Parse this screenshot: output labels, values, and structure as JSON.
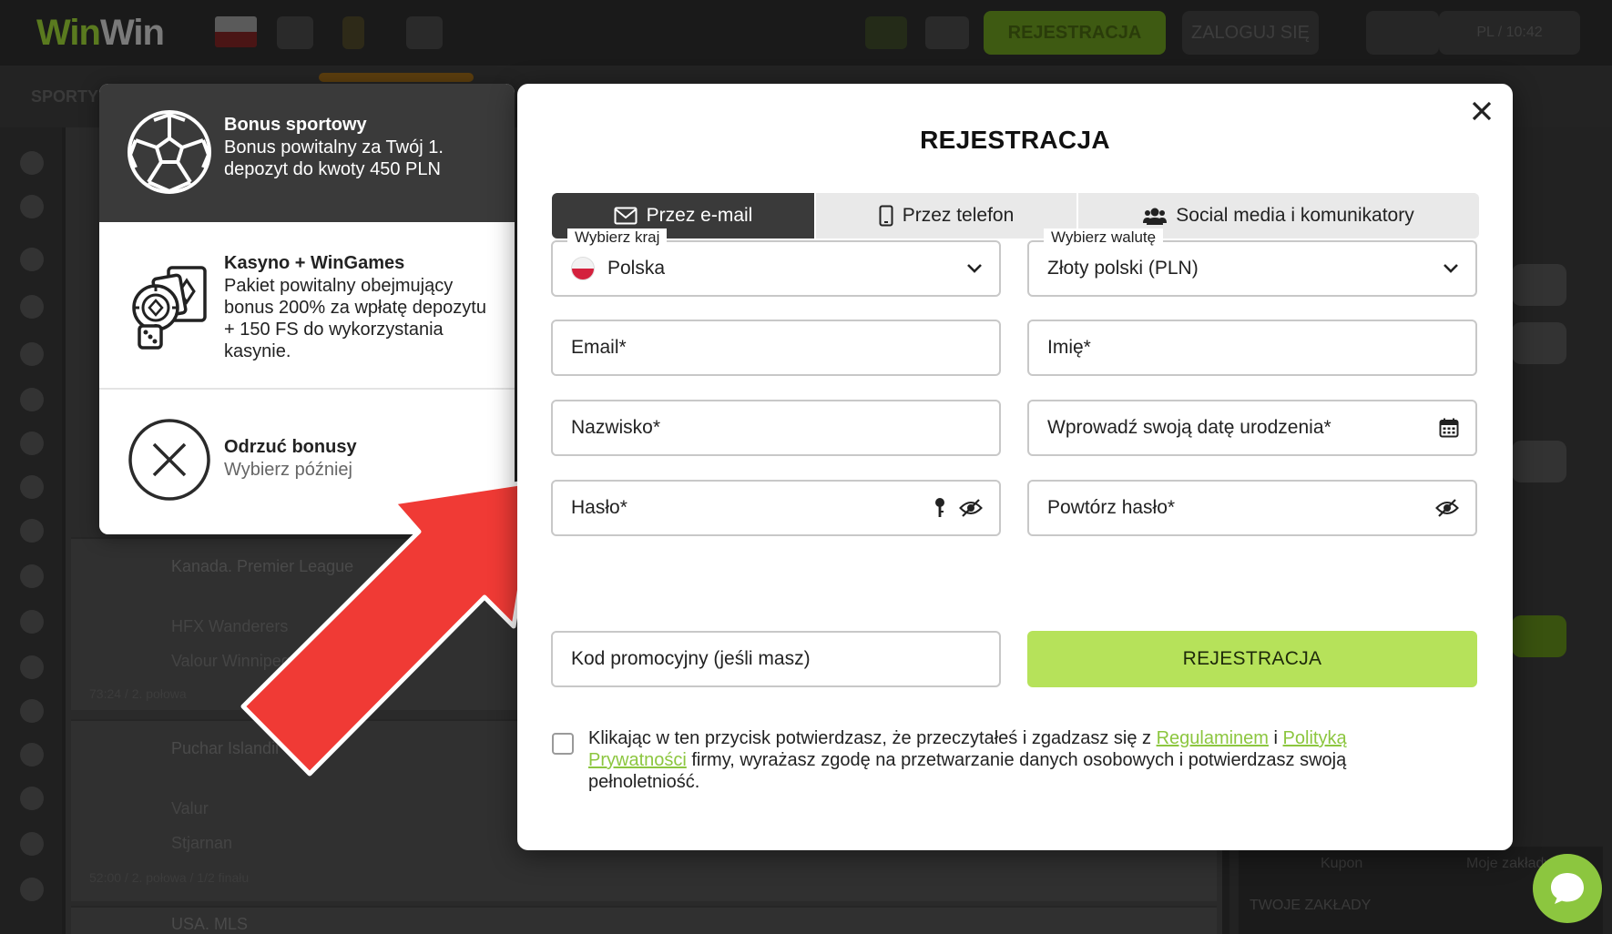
{
  "site": {
    "logo_part1": "Win",
    "logo_part2": "Win",
    "register_button": "REJESTRACJA",
    "login_button": "ZALOGUJ SIĘ",
    "language": "PL / 10:42",
    "nav_sport": "SPORTY"
  },
  "background": {
    "rows": [
      {
        "league": "Kanada. Premier League",
        "team1": "HFX Wanderers",
        "team2": "Valour Winnipeg",
        "meta": "73:24 / 2. połowa"
      },
      {
        "league": "Puchar Islandii",
        "team1": "Valur",
        "team2": "Stjarnan",
        "meta": "52:00 / 2. połowa / 1/2 finału"
      },
      {
        "league": "USA. MLS",
        "team1": "",
        "team2": "",
        "meta": ""
      }
    ],
    "right_tabs": [
      "Kupon",
      "Moje zakłady"
    ],
    "right_footer": "TWOJE ZAKŁADY"
  },
  "bonus_panel": {
    "items": [
      {
        "title": "Bonus sportowy",
        "description": "Bonus powitalny za Twój 1. depozyt do kwoty 450 PLN",
        "icon": "soccer-ball-icon",
        "selected": true
      },
      {
        "title": "Kasyno + WinGames",
        "description": "Pakiet powitalny obejmujący bonus 200% za wpłatę depozytu + 150 FS do wykorzystania kasynie.",
        "icon": "casino-chips-icon",
        "selected": false
      },
      {
        "title": "Odrzuć bonusy",
        "description": "Wybierz później",
        "icon": "x-circle-icon",
        "selected": false
      }
    ]
  },
  "modal": {
    "title": "REJESTRACJA",
    "tabs": {
      "email": "Przez e-mail",
      "phone": "Przez telefon",
      "social": "Social media i komunikatory"
    },
    "country": {
      "label": "Wybierz kraj",
      "value": "Polska"
    },
    "currency": {
      "label": "Wybierz walutę",
      "value": "Złoty polski (PLN)"
    },
    "email_placeholder": "Email*",
    "firstname_placeholder": "Imię*",
    "lastname_placeholder": "Nazwisko*",
    "birthdate_placeholder": "Wprowadź swoją datę urodzenia*",
    "password_placeholder": "Hasło*",
    "password_repeat_placeholder": "Powtórz hasło*",
    "promo_placeholder": "Kod promocyjny (jeśli masz)",
    "submit_label": "REJESTRACJA",
    "consent": {
      "part1": "Klikając w ten przycisk potwierdzasz, że przeczytałeś i zgadzasz się z ",
      "link_terms": "Regulaminem",
      "part2": " i ",
      "link_privacy": "Polityką Prywatności",
      "part3": " firmy, wyrażasz zgodę na przetwarzanie danych osobowych i potwierdzasz swoją pełnoletniość."
    }
  },
  "colors": {
    "accent_green": "#b6e25a",
    "link_green": "#8cc63f",
    "tab_active": "#3a3a3a",
    "arrow_red": "#f03a35"
  }
}
